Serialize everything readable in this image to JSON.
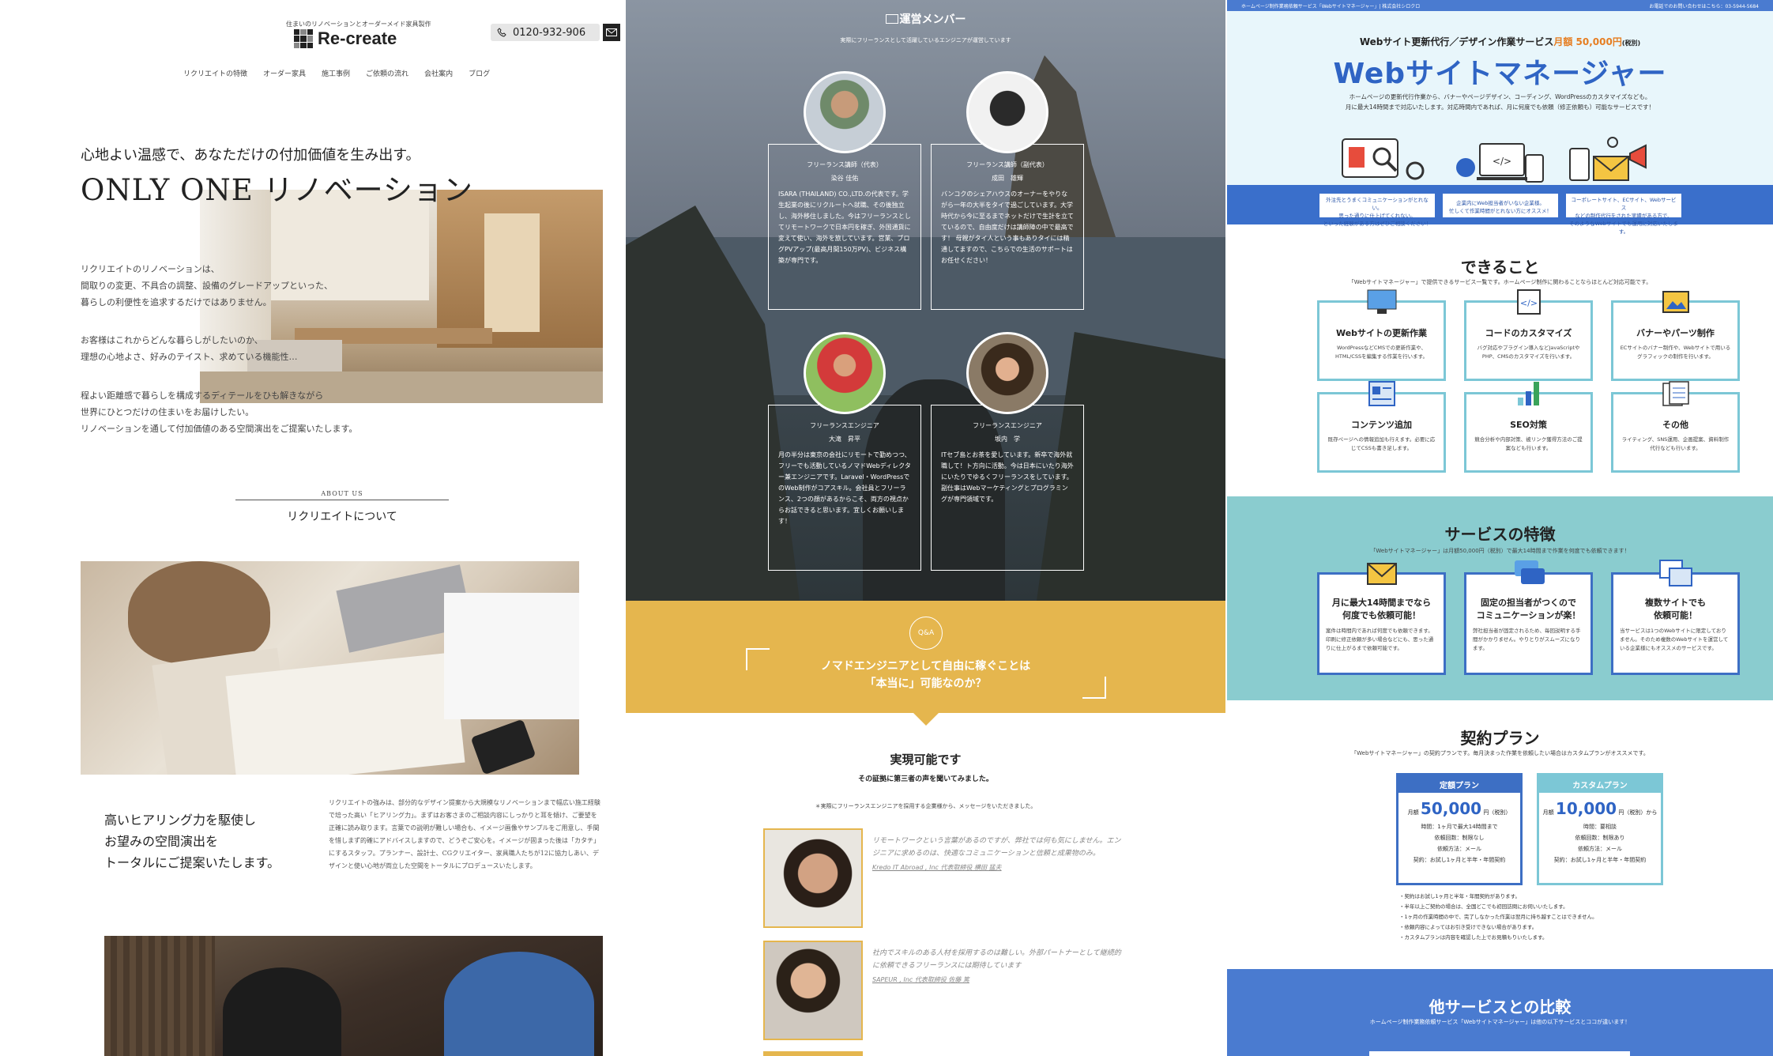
{
  "recreate": {
    "tagline": "住まいのリノベーションとオーダーメイド家具製作",
    "logo_text": "Re-create",
    "phone": "0120-932-906",
    "nav": [
      "リクリエイトの特徴",
      "オーダー家具",
      "施工事例",
      "ご依頼の流れ",
      "会社案内",
      "ブログ"
    ],
    "lead": "心地よい温感で、あなただけの付加価値を生み出す。",
    "title": "ONLY ONE リノベーション",
    "body1": [
      "リクリエイトのリノベーションは、",
      "間取りの変更、不具合の調整、設備のグレードアップといった、",
      "暮らしの利便性を追求するだけではありません。"
    ],
    "body2": [
      "お客様はこれからどんな暮らしがしたいのか、",
      "理想の心地よさ、好みのテイスト、求めている機能性…"
    ],
    "body3": [
      "程よい距離感で暮らしを構成するディテールをひも解きながら",
      "世界にひとつだけの住まいをお届けしたい。",
      "リノベーションを通して付加価値のある空間演出をご提案いたします。"
    ],
    "about_small": "ABOUT US",
    "about_title": "リクリエイトについて",
    "h3_lines": [
      "高いヒアリング力を駆使し",
      "お望みの空間演出を",
      "トータルにご提案いたします。"
    ],
    "p3": "リクリエイトの強みは、部分的なデザイン提案から大規模なリノベーションまで幅広い施工経験で培った高い「ヒアリング力」。まずはお客さまのご相談内容にしっかりと耳を傾け、ご要望を正確に読み取ります。言葉での説明が難しい場合も、イメージ画像やサンプルをご用意し、手間を惜しまず的確にアドバイスしますので、どうぞご安心を。イメージが固まった後は「カタチ」にするスタッフ。プランナー、設計士、CGクリエイター、家具職人たちが12に協力しあい、デザインと使い心地が両立した空間をトータルにプロデュースいたします。"
  },
  "nomad": {
    "section_title": "運営メンバー",
    "section_sub": "実際にフリーランスとして活躍しているエンジニアが運営しています",
    "members": [
      {
        "role": "フリーランス講師（代表）",
        "name": "染谷 佳佑",
        "text": "ISARA (THAILAND) CO.,LTD.の代表です。学生起業の後にリクルートへ就職、その後独立し、海外移住しました。今はフリーランスとしてリモートワークで日本円を稼ぎ、外国通貨に変えて使い、海外を旅しています。営業、ブログPVアップ(最高月間150万PV)、ビジネス構築が専門です。"
      },
      {
        "role": "フリーランス講師（副代表）",
        "name": "成田　雄輝",
        "text": "バンコクのシェアハウスのオーナーをやりながら一年の大半をタイで過ごしています。大学時代から今に至るまでネットだけで生計を立てているので、自由度だけは講師陣の中で最高です！ 母親がタイ人という事もありタイには精通してますので、こちらでの生活のサポートはお任せください！"
      },
      {
        "role": "フリーランスエンジニア",
        "name": "大滝　昇平",
        "text": "月の半分は東京の会社にリモートで勤めつつ、フリーでも活動しているノマドWebディレクター兼エンジニアです。Laravel・WordPressでのWeb制作がコアスキル。会社員とフリーランス、2つの顔があるからこそ、両方の視点からお話できると思います。宜しくお願いします！"
      },
      {
        "role": "フリーランスエンジニア",
        "name": "坂内　学",
        "text": "ITセブ島とお茶を愛しています。新卒で海外就職して！ト方向に活動。今は日本にいたり海外にいたりでゆるくフリーランスをしています。副仕事はWebマーケティングとプログラミングが専門領域です。"
      }
    ],
    "qa_badge": "Q&A",
    "qa_lines": [
      "ノマドエンジニアとして自由に稼ぐことは",
      "「本当に」可能なのか？"
    ],
    "h2": "実現可能です",
    "h2_sub": "その証拠に第三者の声を聞いてみました。",
    "note": "＊実際にフリーランスエンジニアを採用する企業様から、メッセージをいただきました。",
    "testimonials": [
      {
        "quote": "リモートワークという言葉があるのですが、弊社では何も気にしません。エンジニアに求めるのは、快適なコミュニケーションと信頼と成果物のみ。",
        "name": "Kredo IT Abroad , Inc 代表取締役 横田 猛夫"
      },
      {
        "quote": "社内でスキルのある人材を採用するのは難しい。外部パートナーとして継続的に依頼できるフリーランスには期待しています",
        "name": "SAPEUR , Inc 代表取締役 佐藤 篤"
      }
    ]
  },
  "webmgr": {
    "topbar_left": "ホームページ制作業務依頼サービス「Webサイトマネージャー」| 株式会社シロクロ",
    "topbar_right": "お電話でのお問い合わせはこちら：03-5944-5684",
    "pre": "Webサイト更新代行／デザイン作業サービス",
    "pre_price": "月額 50,000円",
    "pre_tax": "(税別)",
    "title": "Webサイトマネージャー",
    "desc": [
      "ホームページの更新代行作業から、バナーやページデザイン、コーディング、WordPressのカスタマイズなども。",
      "月に最大14時間まで対応いたします。対応時間内であれば、月に何度でも依頼（修正依頼も）可能なサービスです！"
    ],
    "band_boxes": [
      [
        "外注先とうまくコミュニケーションがとれない。",
        "思った通りに仕上げてくれない。",
        "といった経験がある方はぜひご相談ください！"
      ],
      [
        "企業内にWeb担当者がいない企業様。",
        "忙しくて作業時間がとれない方にオススメ！"
      ],
      [
        "コーポレートサイト、ECサイト、Webサービス",
        "などの制作代行をされた実績がある方で、",
        "そのようなWebサイトでも運用に対応いたします。"
      ]
    ],
    "can_title": "できること",
    "can_sub": "「Webサイトマネージャー」で提供できるサービス一覧です。ホームページ制作に関わることならほとんど対応可能です。",
    "services": [
      {
        "title": "Webサイトの更新作業",
        "desc": "WordPressなどCMSでの更新作業や、HTML/CSSを編集する作業を行います。"
      },
      {
        "title": "コードのカスタマイズ",
        "desc": "バグ対応やプラグイン導入などJavaScriptやPHP、CMSのカスタマイズを行います。"
      },
      {
        "title": "バナーやパーツ制作",
        "desc": "ECサイトのバナー制作や、Webサイトで用いるグラフィックの制作を行います。"
      },
      {
        "title": "コンテンツ追加",
        "desc": "既存ページへの情報追加も行えます。必要に応じてCSSも書き足します。"
      },
      {
        "title": "SEO対策",
        "desc": "競合分析や内部対策、被リンク獲得方法のご提案なども行います。"
      },
      {
        "title": "その他",
        "desc": "ライティング、SNS運用、企画提案、資料制作代行なども行います。"
      }
    ],
    "feat_title": "サービスの特徴",
    "feat_sub": "「Webサイトマネージャー」は月額50,000円（税別）で最大14時間まで作業を何度でも依頼できます！",
    "features": [
      {
        "title": [
          "月に最大14時間までなら",
          "何度でも依頼可能！"
        ],
        "desc": "案件は時間内であれば何度でも依頼できます。印刷に修正依頼が多い場合などにも、思った通りに仕上がるまで依頼可能です。"
      },
      {
        "title": [
          "固定の担当者がつくので",
          "コミュニケーションが楽！"
        ],
        "desc": "弊社担当者が固定されるため、毎回説明する手間がかかりません。やりとりがスムーズになります。"
      },
      {
        "title": [
          "複数サイトでも",
          "依頼可能！"
        ],
        "desc": "当サービスは1つのWebサイトに限定しておりません。そのため複数のWebサイトを運営している企業様にもオススメのサービスです。"
      }
    ],
    "plan_title": "契約プラン",
    "plan_sub": "「Webサイトマネージャー」の契約プランです。毎月決まった作業を依頼したい場合はカスタムプランがオススメです。",
    "plans": [
      {
        "name": "定額プラン",
        "prefix": "月額",
        "price": "50,000",
        "unit": "円（税別）",
        "lines": [
          "時間：1ヶ月で最大14時間まで",
          "依頼回数：制限なし",
          "依頼方法：メール",
          "契約：お試し1ヶ月と半年・年間契約"
        ],
        "color": "#3d6fc4"
      },
      {
        "name": "カスタムプラン",
        "prefix": "月額",
        "price": "10,000",
        "unit": "円（税別）から",
        "lines": [
          "時間：要相談",
          "依頼回数：制限あり",
          "依頼方法：メール",
          "契約：お試し1ヶ月と半年・年間契約"
        ],
        "color": "#7cc7d6"
      }
    ],
    "plan_notes": [
      "・契約はお試し1ヶ月と半年・年間契約があります。",
      "・半年以上ご契約の場合は、全国どこでも初回訪問にお伺いいたします。",
      "・1ヶ月の作業時間の中で、完了しなかった作業は翌月に持ち越すことはできません。",
      "・依頼内容によってはお引き受けできない場合があります。",
      "・カスタムプランは内容を確認した上でお見積もりいたします。"
    ],
    "cmp_title": "他サービスとの比較",
    "cmp_sub": "ホームページ制作業務依頼サービス「Webサイトマネージャー」は他の以下サービスとココが違います！"
  }
}
